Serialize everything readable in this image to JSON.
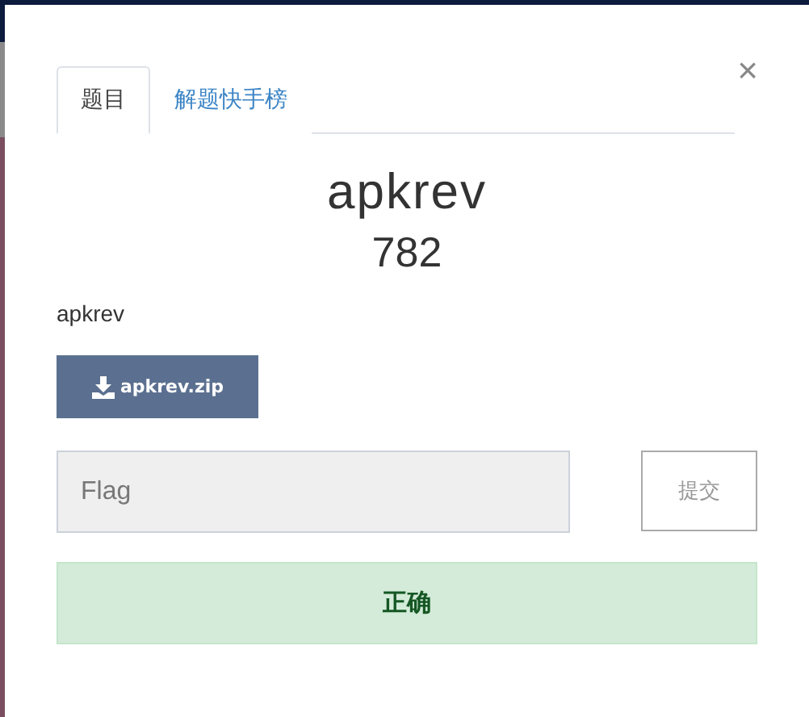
{
  "tabs": [
    {
      "label": "题目",
      "selected": true
    },
    {
      "label": "解题快手榜",
      "selected": false
    }
  ],
  "close": "×",
  "challenge": {
    "title": "apkrev",
    "score": "782",
    "description": "apkrev"
  },
  "download": {
    "label": "apkrev.zip"
  },
  "flag": {
    "placeholder": "Flag"
  },
  "submit": {
    "label": "提交"
  },
  "result": {
    "kind": "success",
    "text": "正确"
  }
}
